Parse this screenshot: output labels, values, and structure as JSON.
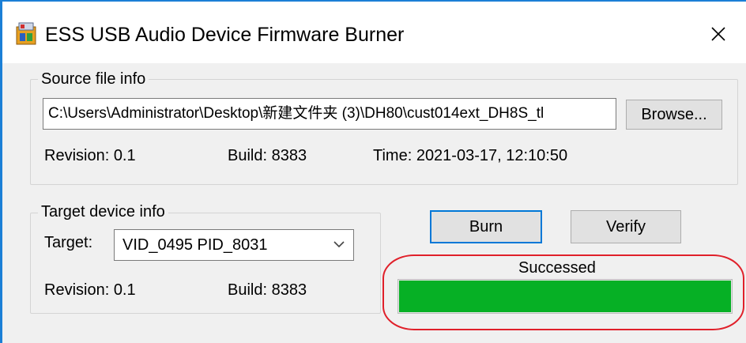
{
  "window": {
    "title": "ESS USB Audio Device Firmware Burner",
    "close_glyph": "✕"
  },
  "source": {
    "group_label": "Source file info",
    "path_value": "C:\\Users\\Administrator\\Desktop\\新建文件夹 (3)\\DH80\\cust014ext_DH8S_tl",
    "browse_label": "Browse...",
    "revision_label": "Revision: 0.1",
    "build_label": "Build:  8383",
    "time_label": "Time:  2021-03-17, 12:10:50"
  },
  "target": {
    "group_label": "Target device info",
    "target_label": "Target:",
    "selected_value": "VID_0495  PID_8031",
    "revision_label": "Revision: 0.1",
    "build_label": "Build:  8383"
  },
  "actions": {
    "burn_label": "Burn",
    "verify_label": "Verify"
  },
  "status": {
    "text": "Successed",
    "progress_percent": 100,
    "progress_color": "#06b025",
    "annotation_color": "#e0202a"
  },
  "icons": {
    "app": "firmware-burner-app-icon",
    "close": "close-icon",
    "dropdown": "chevron-down-icon"
  }
}
